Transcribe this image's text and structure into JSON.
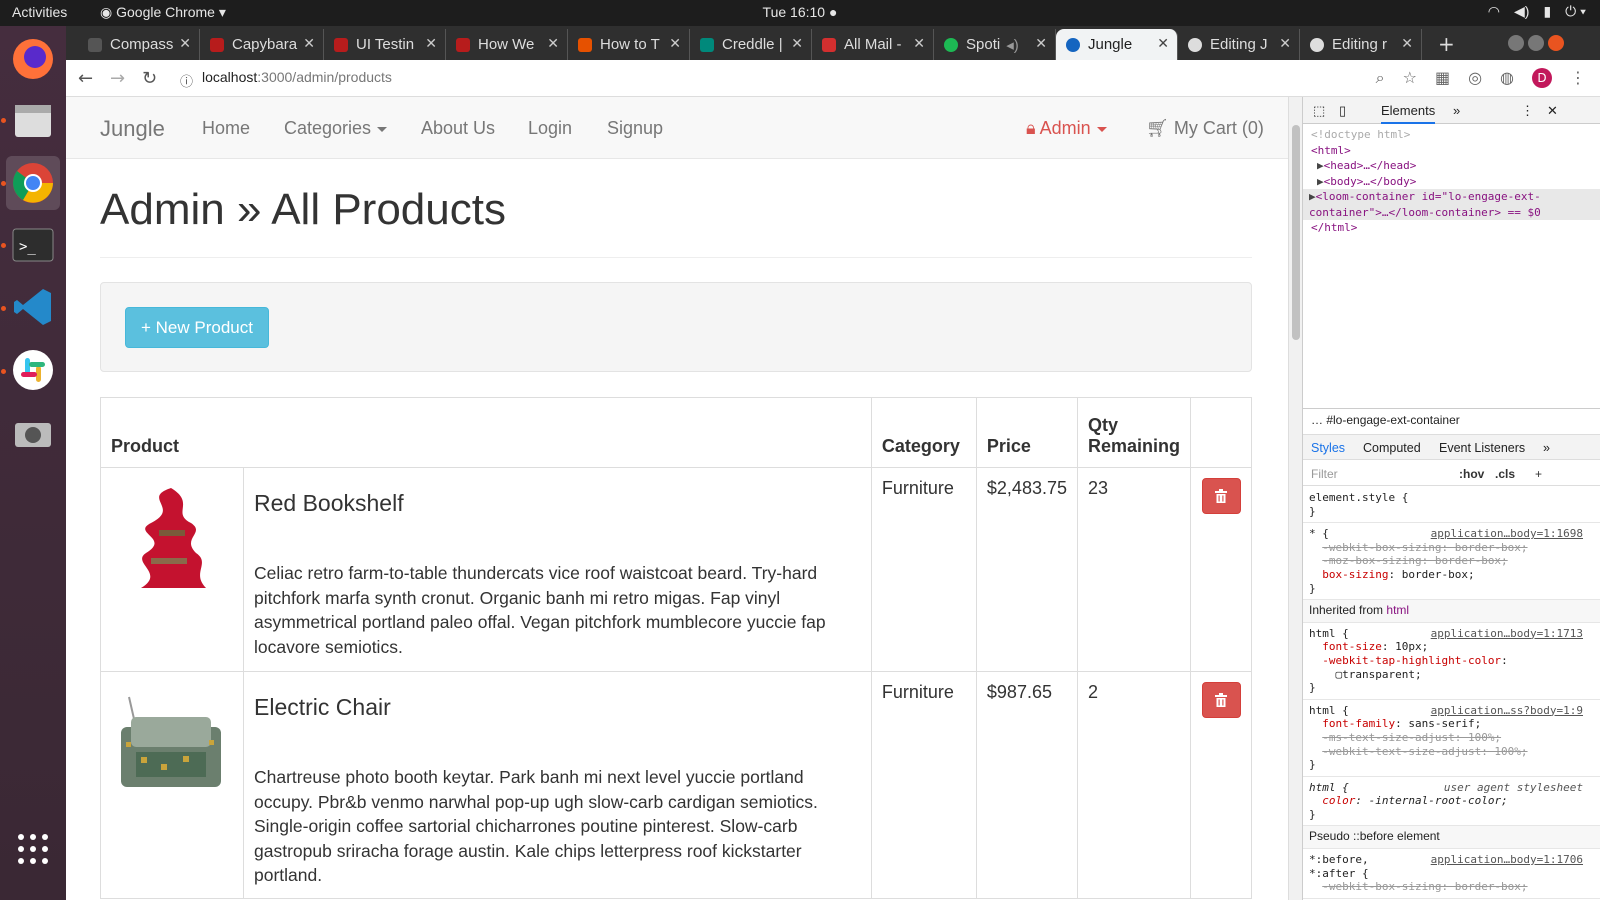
{
  "system": {
    "activities": "Activities",
    "app_menu": "Google Chrome",
    "clock": "Tue 16:10"
  },
  "browser": {
    "tabs": [
      {
        "label": "Compass",
        "color": "#555"
      },
      {
        "label": "Capybara",
        "color": "#b71c1c"
      },
      {
        "label": "UI Testin",
        "color": "#b71c1c"
      },
      {
        "label": "How We",
        "color": "#b71c1c"
      },
      {
        "label": "How to T",
        "color": "#e65100"
      },
      {
        "label": "Creddle |",
        "color": "#00897b"
      },
      {
        "label": "All Mail -",
        "color": "#d32f2f"
      },
      {
        "label": "Spoti",
        "color": "#1db954"
      },
      {
        "label": "Jungle",
        "color": "#1565c0"
      },
      {
        "label": "Editing J",
        "color": "#333"
      },
      {
        "label": "Editing r",
        "color": "#333"
      }
    ],
    "url_host": "localhost",
    "url_path": ":3000/admin/products",
    "profile_initial": "D"
  },
  "navbar": {
    "brand": "Jungle",
    "links": [
      "Home",
      "Categories",
      "About Us",
      "Login",
      "Signup"
    ],
    "admin": "Admin",
    "cart": "My Cart (0)"
  },
  "page": {
    "title": "Admin » All Products",
    "new_product_button": "+ New Product"
  },
  "table": {
    "headers": [
      "Product",
      "Category",
      "Price",
      "Qty Remaining",
      ""
    ],
    "rows": [
      {
        "name": "Red Bookshelf",
        "description": "Celiac retro farm-to-table thundercats vice roof waistcoat beard. Try-hard pitchfork marfa synth cronut. Organic banh mi retro migas. Fap vinyl asymmetrical portland paleo offal. Vegan pitchfork mumblecore yuccie fap locavore semiotics.",
        "category": "Furniture",
        "price": "$2,483.75",
        "qty": "23"
      },
      {
        "name": "Electric Chair",
        "description": "Chartreuse photo booth keytar. Park banh mi next level yuccie portland occupy. Pbr&b venmo narwhal pop-up ugh slow-carb cardigan semiotics. Single-origin coffee sartorial chicharrones poutine pinterest. Slow-carb gastropub sriracha forage austin. Kale chips letterpress roof kickstarter portland.",
        "category": "Furniture",
        "price": "$987.65",
        "qty": "2"
      }
    ]
  },
  "devtools": {
    "tab_elements": "Elements",
    "dom_lines": [
      "<!doctype html>",
      "<html>",
      "<head>…</head>",
      "<body>…</body>",
      "<loom-container id=\"lo-engage-ext-container\">…</loom-container> == $0",
      "</html>"
    ],
    "breadcrumb": "#lo-engage-ext-container",
    "subtabs": [
      "Styles",
      "Computed",
      "Event Listeners"
    ],
    "filter_placeholder": "Filter",
    "hov": ":hov",
    "cls": ".cls",
    "inherited": "Inherited from",
    "inherited_tag": "html",
    "pseudo": "Pseudo ::before element"
  }
}
